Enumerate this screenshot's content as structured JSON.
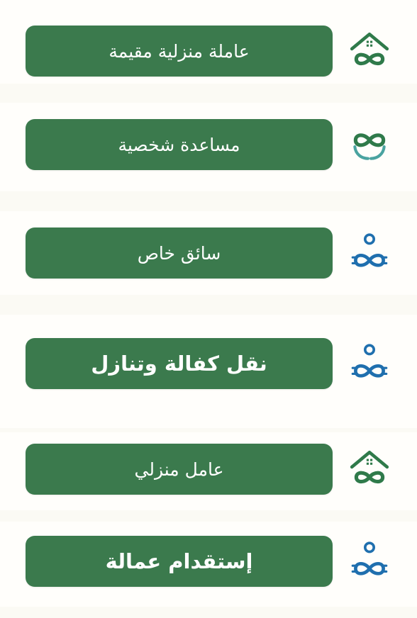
{
  "colors": {
    "button_bg": "#3b7a4d",
    "button_text": "#ffffff",
    "icon_green": "#2f7a4a",
    "icon_blue": "#1f6fae",
    "page_bg": "#fbfaf4"
  },
  "services": [
    {
      "label": "عاملة منزلية مقيمة",
      "icon": "home-infinity-icon"
    },
    {
      "label": "مساعدة شخصية",
      "icon": "hands-infinity-icon"
    },
    {
      "label": "سائق خاص",
      "icon": "person-infinity-icon"
    },
    {
      "label": "نقل كفالة وتنازل",
      "icon": "person-infinity-icon"
    },
    {
      "label": "عامل منزلي",
      "icon": "home-infinity-icon"
    },
    {
      "label": "إستقدام عمالة",
      "icon": "person-infinity-icon"
    }
  ]
}
